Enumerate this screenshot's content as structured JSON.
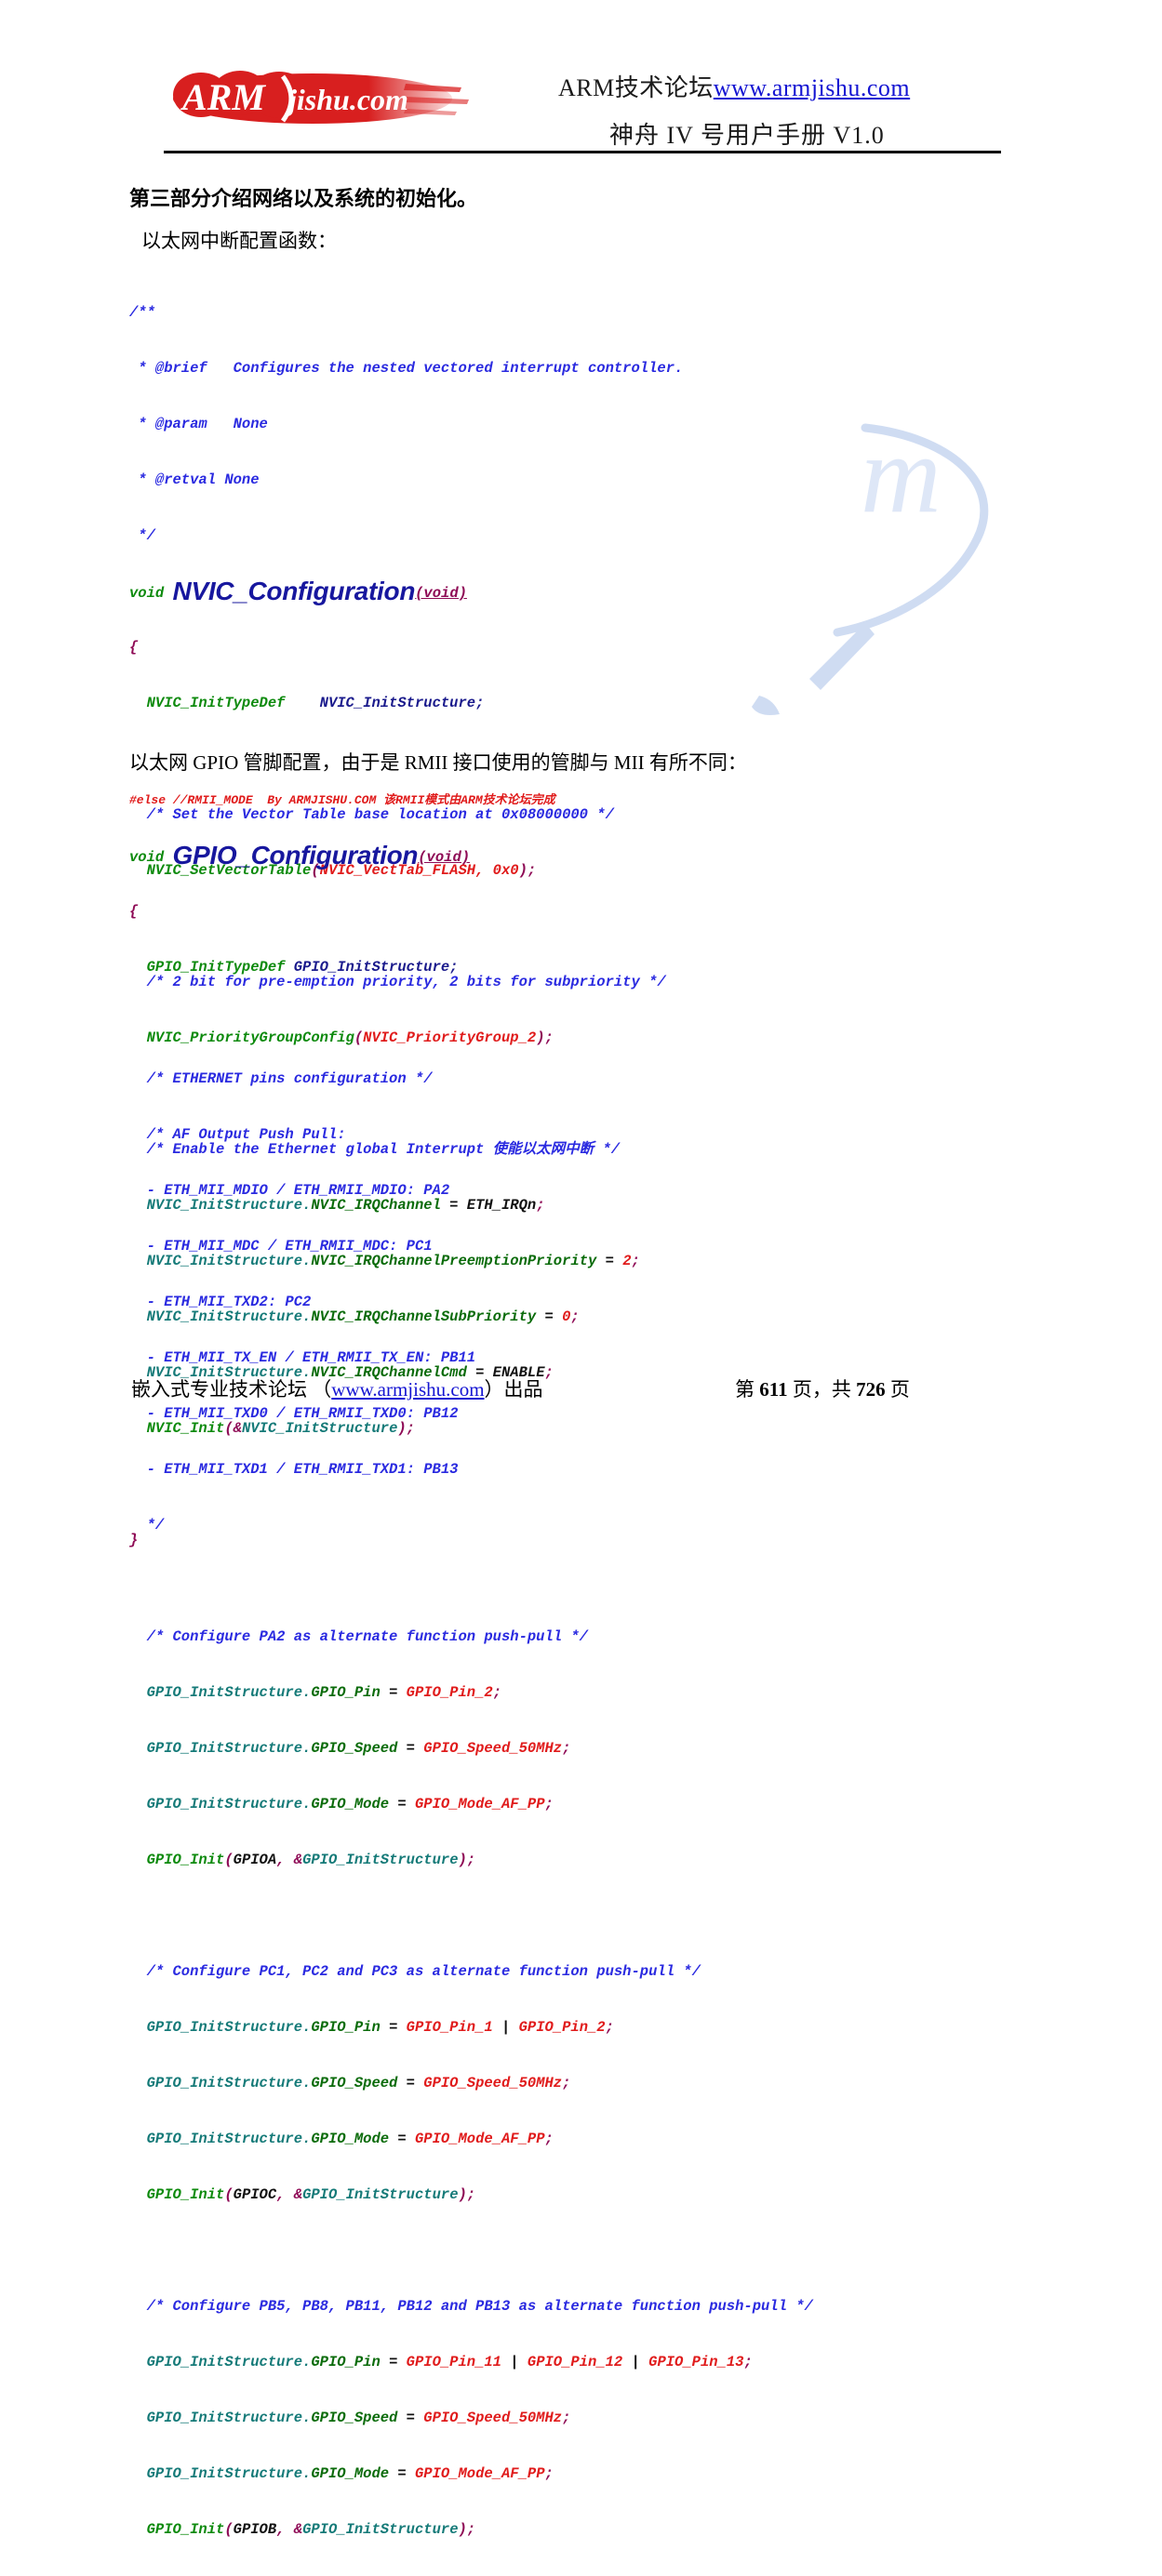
{
  "header": {
    "logo_text": "ARM",
    "logo_text2": "jishu.com",
    "line1_prefix": "ARM技术论坛",
    "line1_link": "www.armjishu.com",
    "line2": "神舟 IV 号用户手册 V1.0"
  },
  "body": {
    "section_title": "第三部分介绍网络以及系统的初始化。",
    "lead1": "以太网中断配置函数：",
    "lead2": "以太网 GPIO 管脚配置，由于是 RMII 接口使用的管脚与 MII 有所不同："
  },
  "code1": {
    "lines": [
      "/**",
      " * @brief   Configures the nested vectored interrupt controller.",
      " * @param   None",
      " * @retval None",
      " */",
      "void NVIC_Configuration(void)",
      "{",
      "  NVIC_InitTypeDef    NVIC_InitStructure;",
      "",
      "  /* Set the Vector Table base location at 0x08000000 */",
      "  NVIC_SetVectorTable(NVIC_VectTab_FLASH, 0x0);",
      "",
      "  /* 2 bit for pre-emption priority, 2 bits for subpriority */",
      "  NVIC_PriorityGroupConfig(NVIC_PriorityGroup_2);",
      "",
      "  /* Enable the Ethernet global Interrupt 使能以太网中断 */",
      "  NVIC_InitStructure.NVIC_IRQChannel = ETH_IRQn;",
      "  NVIC_InitStructure.NVIC_IRQChannelPreemptionPriority = 2;",
      "  NVIC_InitStructure.NVIC_IRQChannelSubPriority = 0;",
      "  NVIC_InitStructure.NVIC_IRQChannelCmd = ENABLE;",
      "  NVIC_Init(&NVIC_InitStructure);",
      "",
      "}"
    ],
    "function_name": "NVIC_Configuration",
    "keyword_void": "void",
    "param_void": "(void)"
  },
  "code2": {
    "preproc_line": "#else //RMII_MODE  By ARMJISHU.COM 该RMII模式由ARM技术论坛完成",
    "function_name": "GPIO_Configuration",
    "keyword_void": "void",
    "param_void": "(void)",
    "lines": [
      "{",
      "  GPIO_InitTypeDef GPIO_InitStructure;",
      "",
      "  /* ETHERNET pins configuration */",
      "  /* AF Output Push Pull:",
      "  - ETH_MII_MDIO / ETH_RMII_MDIO: PA2",
      "  - ETH_MII_MDC / ETH_RMII_MDC: PC1",
      "  - ETH_MII_TXD2: PC2",
      "  - ETH_MII_TX_EN / ETH_RMII_TX_EN: PB11",
      "  - ETH_MII_TXD0 / ETH_RMII_TXD0: PB12",
      "  - ETH_MII_TXD1 / ETH_RMII_TXD1: PB13",
      "  */",
      "",
      "  /* Configure PA2 as alternate function push-pull */",
      "  GPIO_InitStructure.GPIO_Pin = GPIO_Pin_2;",
      "  GPIO_InitStructure.GPIO_Speed = GPIO_Speed_50MHz;",
      "  GPIO_InitStructure.GPIO_Mode = GPIO_Mode_AF_PP;",
      "  GPIO_Init(GPIOA, &GPIO_InitStructure);",
      "",
      "  /* Configure PC1, PC2 and PC3 as alternate function push-pull */",
      "  GPIO_InitStructure.GPIO_Pin = GPIO_Pin_1 | GPIO_Pin_2;",
      "  GPIO_InitStructure.GPIO_Speed = GPIO_Speed_50MHz;",
      "  GPIO_InitStructure.GPIO_Mode = GPIO_Mode_AF_PP;",
      "  GPIO_Init(GPIOC, &GPIO_InitStructure);",
      "",
      "  /* Configure PB5, PB8, PB11, PB12 and PB13 as alternate function push-pull */",
      "  GPIO_InitStructure.GPIO_Pin = GPIO_Pin_11 | GPIO_Pin_12 | GPIO_Pin_13;",
      "  GPIO_InitStructure.GPIO_Speed = GPIO_Speed_50MHz;",
      "  GPIO_InitStructure.GPIO_Mode = GPIO_Mode_AF_PP;",
      "  GPIO_Init(GPIOB, &GPIO_InitStructure);"
    ]
  },
  "footer": {
    "left_prefix": "嵌入式专业技术论坛 （",
    "left_link": "www.armjishu.com",
    "left_suffix": "）出品",
    "page_label_1": "第",
    "page_current": "611",
    "page_label_2": "页，共",
    "page_total": "726",
    "page_label_3": "页"
  },
  "colors": {
    "comment": "#2a2ae0",
    "keyword": "#0d8a0d",
    "identifier": "#157a78",
    "number": "#e01b1b",
    "punct": "#8e0a55",
    "function_title": "#17179e",
    "logo_red": "#d81f1f",
    "link": "#1414d2"
  }
}
